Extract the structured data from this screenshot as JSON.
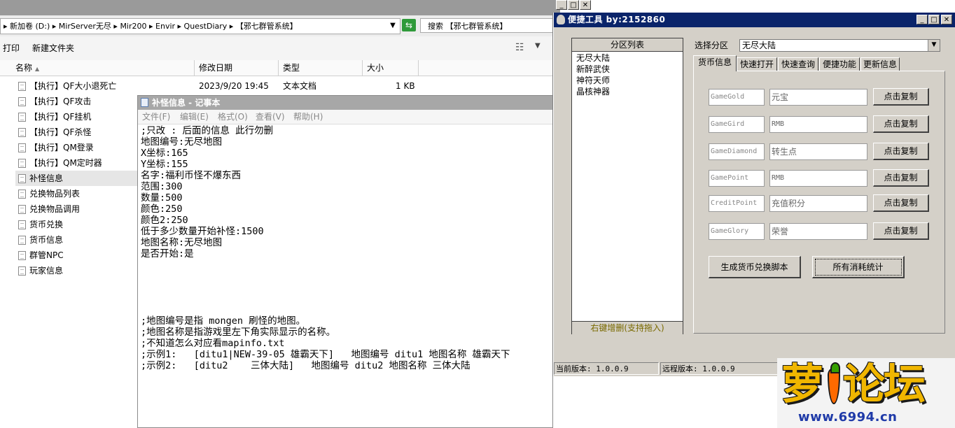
{
  "explorer": {
    "address": "▸ 新加卷 (D:) ▸ MirServer无尽 ▸ Mir200 ▸ Envir ▸ QuestDiary ▸ 【邪七群管系统】",
    "search_placeholder": "搜索 【邪七群管系统】",
    "toolbar": {
      "print": "打印",
      "new_folder": "新建文件夹"
    },
    "columns": {
      "name": "名称",
      "modified": "修改日期",
      "type": "类型",
      "size": "大小"
    },
    "files": [
      "【执行】QF大小退死亡",
      "【执行】QF攻击",
      "【执行】QF挂机",
      "【执行】QF杀怪",
      "【执行】QM登录",
      "【执行】QM定时器",
      "补怪信息",
      "兑换物品列表",
      "兑换物品调用",
      "货币兑换",
      "货币信息",
      "群管NPC",
      "玩家信息"
    ],
    "first_file_meta": {
      "modified": "2023/9/20 19:45",
      "type": "文本文档",
      "size": "1 KB"
    }
  },
  "notepad": {
    "title": "补怪信息 - 记事本",
    "menu": [
      "文件(F)",
      "编辑(E)",
      "格式(O)",
      "查看(V)",
      "帮助(H)"
    ],
    "lines": [
      ";只改 : 后面的信息 此行勿删",
      "地图编号:无尽地图",
      "X坐标:165",
      "Y坐标:155",
      "名字:福利币怪不爆东西",
      "范围:300",
      "数量:500",
      "颜色:250",
      "颜色2:250",
      "低于多少数量开始补怪:1500",
      "地图名称:无尽地图",
      "是否开始:是",
      "",
      "",
      "",
      "",
      "",
      ";地图编号是指 mongen 刷怪的地图。",
      ";地图名称是指游戏里左下角实际显示的名称。",
      ";不知道怎么对应看mapinfo.txt",
      ";示例1:   [ditu1|NEW-39-05 雄霸天下]   地图编号 ditu1 地图名称 雄霸天下",
      ";示例2:   [ditu2    三体大陆]   地图编号 ditu2 地图名称 三体大陆"
    ]
  },
  "tool": {
    "title": "便捷工具   by:2152860",
    "region_header": "分区列表",
    "regions": [
      "无尽大陆",
      "新醉武侠",
      "神符天师",
      "晶核神器"
    ],
    "region_footer": "右键增删(支持拖入)",
    "select_label": "选择分区",
    "select_value": "无尽大陆",
    "tabs": [
      "货币信息",
      "快速打开",
      "快速查询",
      "便捷功能",
      "更新信息"
    ],
    "currencies": [
      {
        "key": "GameGold",
        "name": "元宝"
      },
      {
        "key": "GameGird",
        "name": "RMB"
      },
      {
        "key": "GameDiamond",
        "name": "转生点"
      },
      {
        "key": "GamePoint",
        "name": "RMB"
      },
      {
        "key": "CreditPoint",
        "name": "充值积分"
      },
      {
        "key": "GameGlory",
        "name": "荣誉"
      }
    ],
    "copy_label": "点击复制",
    "gen_button": "生成货币兑换脚本",
    "stats_button": "所有消耗统计",
    "status_local": "当前版本: 1.0.0.9",
    "status_remote": "远程版本: 1.0.0.9"
  },
  "watermark": {
    "logo_left": "萝",
    "logo_right": "论坛",
    "url": "www.6994.cn"
  },
  "icons": {
    "refresh": "refresh-icon",
    "view": "view-options-icon",
    "file": "text-file-icon",
    "notepad": "notepad-icon",
    "tool": "tool-app-icon"
  },
  "colors": {
    "tool_titlebar": "#0a246a",
    "classic_face": "#d4d0c8",
    "watermark_yellow": "#f0b600",
    "watermark_url": "#1f3aa8"
  }
}
